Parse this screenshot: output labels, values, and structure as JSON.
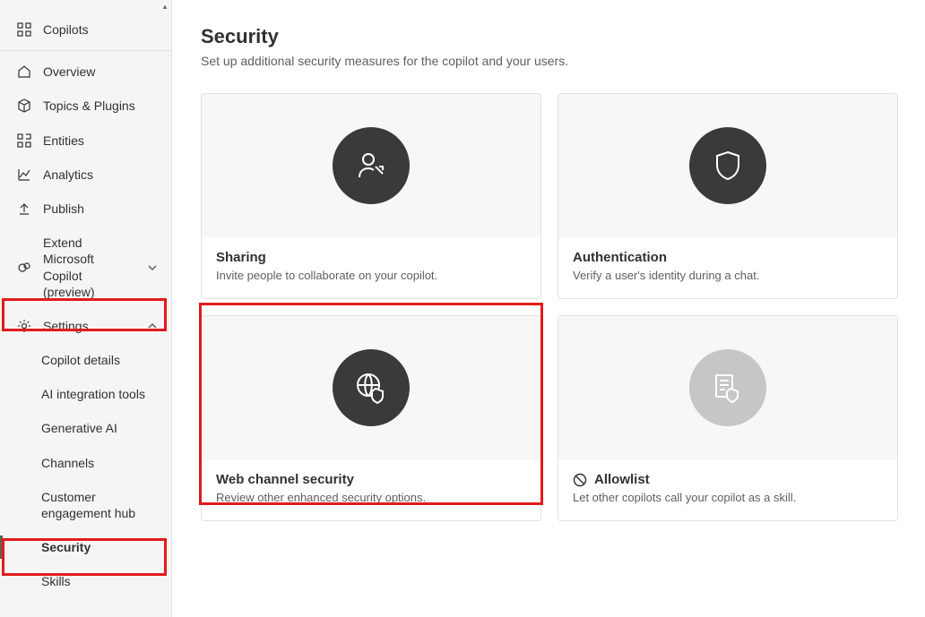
{
  "sidebar": {
    "copilots_label": "Copilots",
    "overview_label": "Overview",
    "topics_label": "Topics & Plugins",
    "entities_label": "Entities",
    "analytics_label": "Analytics",
    "publish_label": "Publish",
    "extend_label": "Extend Microsoft Copilot (preview)",
    "settings_label": "Settings",
    "settings_children": {
      "copilot_details": "Copilot details",
      "ai_integration": "AI integration tools",
      "generative_ai": "Generative AI",
      "channels": "Channels",
      "customer_hub": "Customer engagement hub",
      "security": "Security",
      "skills": "Skills"
    }
  },
  "page": {
    "title": "Security",
    "subtitle": "Set up additional security measures for the copilot and your users."
  },
  "cards": {
    "sharing": {
      "title": "Sharing",
      "desc": "Invite people to collaborate on your copilot."
    },
    "authentication": {
      "title": "Authentication",
      "desc": "Verify a user's identity during a chat."
    },
    "web_security": {
      "title": "Web channel security",
      "desc": "Review other enhanced security options."
    },
    "allowlist": {
      "title": "Allowlist",
      "desc": "Let other copilots call your copilot as a skill."
    }
  }
}
